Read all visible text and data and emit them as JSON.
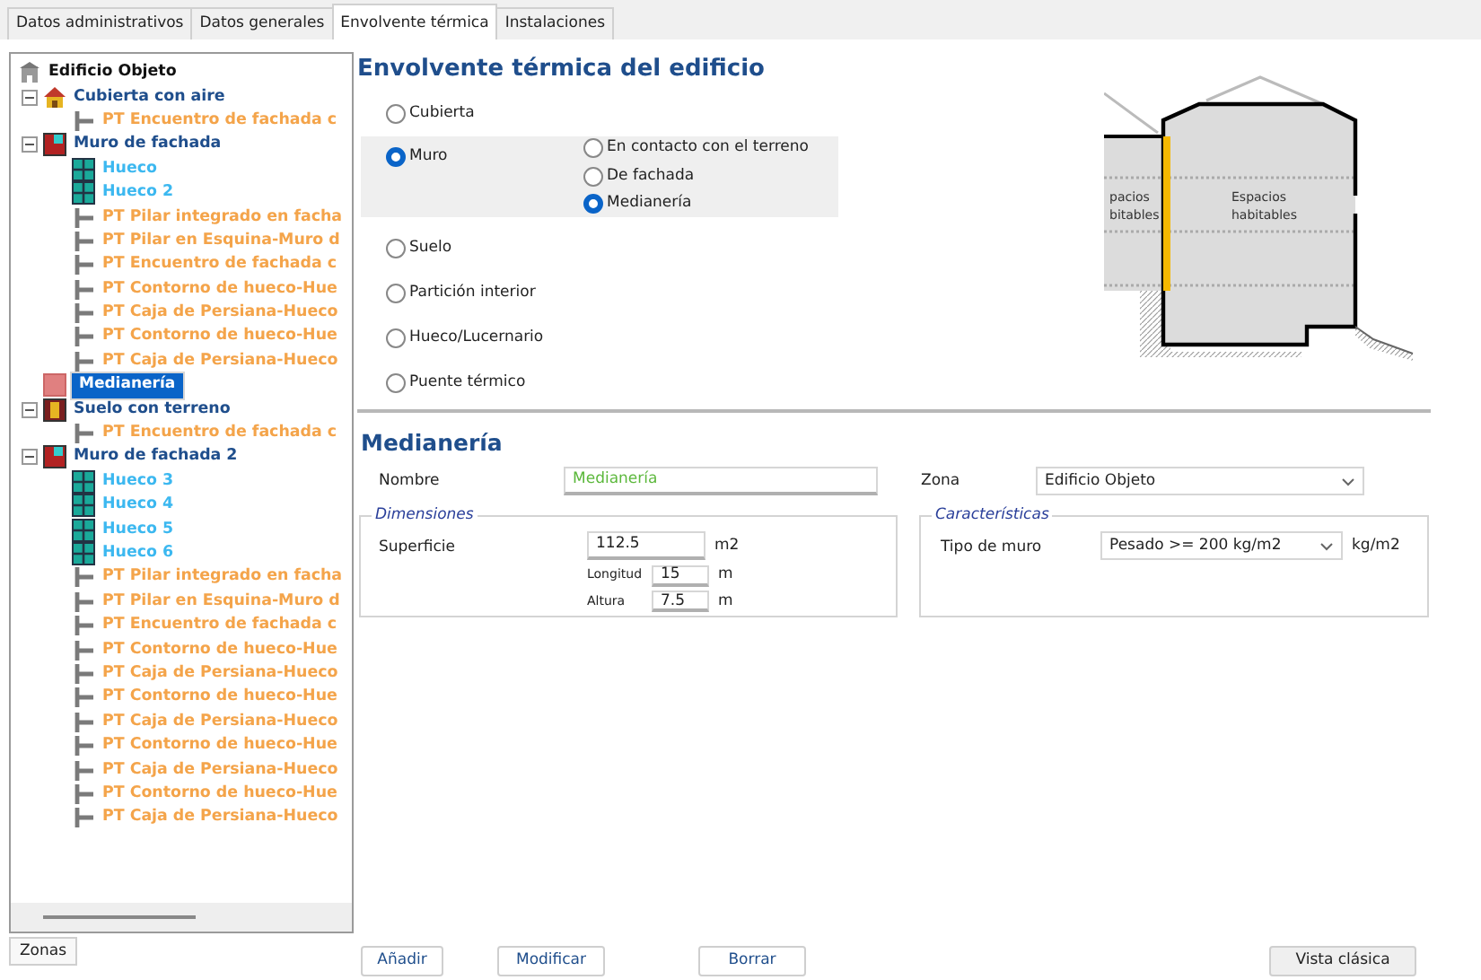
{
  "tabs": [
    {
      "label": "Datos administrativos",
      "selected": false
    },
    {
      "label": "Datos generales",
      "selected": false
    },
    {
      "label": "Envolvente térmica",
      "selected": true
    },
    {
      "label": "Instalaciones",
      "selected": false
    }
  ],
  "tree": {
    "label": "Edificio Objeto",
    "kind": "building",
    "selected": false,
    "children": [
      {
        "label": "Cubierta con aire",
        "kind": "roof",
        "selected": false,
        "expanded": true,
        "children": [
          {
            "label": "PT Encuentro de fachada c",
            "kind": "bridge",
            "selected": false
          }
        ]
      },
      {
        "label": "Muro de fachada",
        "kind": "wall",
        "selected": false,
        "expanded": true,
        "children": [
          {
            "label": "Hueco",
            "kind": "window",
            "selected": false
          },
          {
            "label": "Hueco 2",
            "kind": "window",
            "selected": false
          },
          {
            "label": "PT Pilar integrado en facha",
            "kind": "bridge",
            "selected": false
          },
          {
            "label": "PT Pilar en Esquina-Muro d",
            "kind": "bridge",
            "selected": false
          },
          {
            "label": "PT Encuentro de fachada c",
            "kind": "bridge",
            "selected": false
          },
          {
            "label": "PT Contorno de hueco-Hue",
            "kind": "bridge",
            "selected": false
          },
          {
            "label": "PT Caja de Persiana-Hueco",
            "kind": "bridge",
            "selected": false
          },
          {
            "label": "PT Contorno de hueco-Hue",
            "kind": "bridge",
            "selected": false
          },
          {
            "label": "PT Caja de Persiana-Hueco",
            "kind": "bridge",
            "selected": false
          }
        ]
      },
      {
        "label": "Medianería",
        "kind": "party",
        "selected": true
      },
      {
        "label": "Suelo con terreno",
        "kind": "floor",
        "selected": false,
        "expanded": true,
        "children": [
          {
            "label": "PT Encuentro de fachada c",
            "kind": "bridge",
            "selected": false
          }
        ]
      },
      {
        "label": "Muro de fachada 2",
        "kind": "wall",
        "selected": false,
        "expanded": true,
        "children": [
          {
            "label": "Hueco 3",
            "kind": "window",
            "selected": false
          },
          {
            "label": "Hueco 4",
            "kind": "window",
            "selected": false
          },
          {
            "label": "Hueco 5",
            "kind": "window",
            "selected": false
          },
          {
            "label": "Hueco 6",
            "kind": "window",
            "selected": false
          },
          {
            "label": "PT Pilar integrado en facha",
            "kind": "bridge",
            "selected": false
          },
          {
            "label": "PT Pilar en Esquina-Muro d",
            "kind": "bridge",
            "selected": false
          },
          {
            "label": "PT Encuentro de fachada c",
            "kind": "bridge",
            "selected": false
          },
          {
            "label": "PT Contorno de hueco-Hue",
            "kind": "bridge",
            "selected": false
          },
          {
            "label": "PT Caja de Persiana-Hueco",
            "kind": "bridge",
            "selected": false
          },
          {
            "label": "PT Contorno de hueco-Hue",
            "kind": "bridge",
            "selected": false
          },
          {
            "label": "PT Caja de Persiana-Hueco",
            "kind": "bridge",
            "selected": false
          },
          {
            "label": "PT Contorno de hueco-Hue",
            "kind": "bridge",
            "selected": false
          },
          {
            "label": "PT Caja de Persiana-Hueco",
            "kind": "bridge",
            "selected": false
          },
          {
            "label": "PT Contorno de hueco-Hue",
            "kind": "bridge",
            "selected": false
          },
          {
            "label": "PT Caja de Persiana-Hueco",
            "kind": "bridge",
            "selected": false
          }
        ]
      }
    ]
  },
  "zones_button": "Zonas",
  "title": "Envolvente térmica del edificio",
  "element_types": [
    {
      "label": "Cubierta",
      "selected": false
    },
    {
      "label": "Muro",
      "selected": true
    },
    {
      "label": "Suelo",
      "selected": false
    },
    {
      "label": "Partición interior",
      "selected": false
    },
    {
      "label": "Hueco/Lucernario",
      "selected": false
    },
    {
      "label": "Puente térmico",
      "selected": false
    }
  ],
  "wall_types": [
    {
      "label": "En contacto con el terreno",
      "selected": false
    },
    {
      "label": "De fachada",
      "selected": false
    },
    {
      "label": "Medianería",
      "selected": true
    }
  ],
  "diagram": {
    "labels": [
      {
        "lines": [
          "pacios",
          "bitables"
        ]
      },
      {
        "lines": [
          "Espacios",
          "habitables"
        ]
      }
    ]
  },
  "section_title": "Medianería",
  "nombre": {
    "label": "Nombre",
    "value": "Medianería"
  },
  "zona": {
    "label": "Zona",
    "value": "Edificio Objeto"
  },
  "dimensiones": {
    "legend": "Dimensiones",
    "superficie": {
      "label": "Superficie",
      "value": "112.5",
      "unit": "m2"
    },
    "longitud": {
      "label": "Longitud",
      "value": "15",
      "unit": "m"
    },
    "altura": {
      "label": "Altura",
      "value": "7.5",
      "unit": "m"
    }
  },
  "caracteristicas": {
    "legend": "Características",
    "tipo": {
      "label": "Tipo de muro",
      "value": "Pesado >= 200 kg/m2",
      "unit": "kg/m2"
    }
  },
  "buttons": [
    "Añadir",
    "Modificar",
    "Borrar"
  ],
  "classic_button": "Vista clásica"
}
